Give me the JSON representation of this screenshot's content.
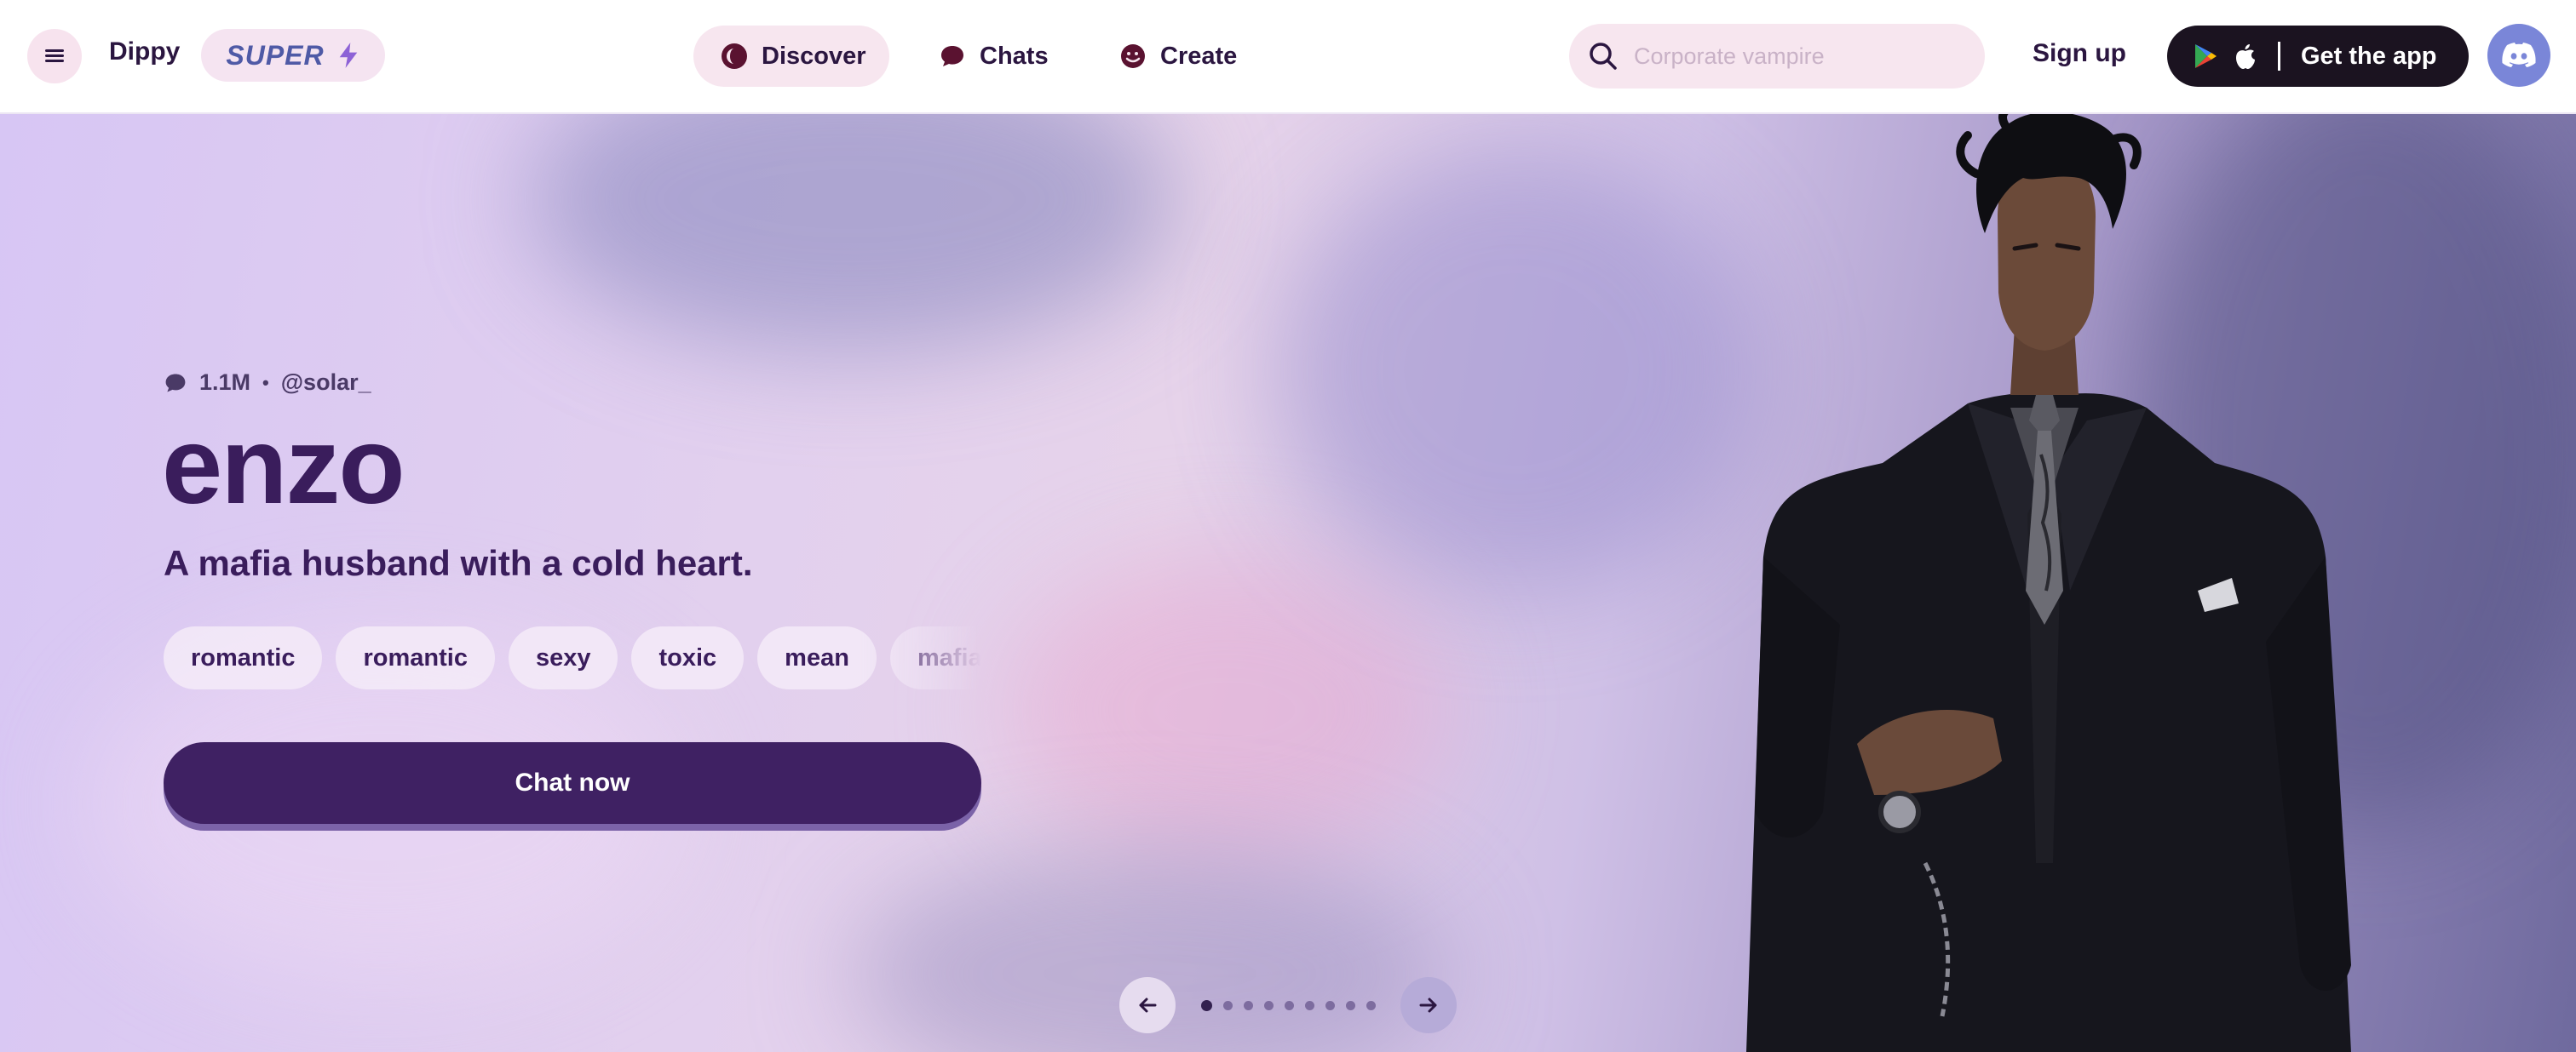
{
  "nav": {
    "brand": "Dippy",
    "super_label": "SUPER",
    "tabs": [
      {
        "label": "Discover",
        "icon": "discover-icon",
        "active": true
      },
      {
        "label": "Chats",
        "icon": "chat-bubble-icon",
        "active": false
      },
      {
        "label": "Create",
        "icon": "create-icon",
        "active": false
      }
    ],
    "search_placeholder": "Corporate vampire",
    "sign_up": "Sign up",
    "get_app": "Get the app"
  },
  "hero": {
    "message_count": "1.1M",
    "separator": "•",
    "creator": "@solar_",
    "name": "enzo",
    "tagline": "A mafia husband with a cold heart.",
    "tags": [
      "romantic",
      "romantic",
      "sexy",
      "toxic",
      "mean",
      "mafia"
    ],
    "cta": "Chat now",
    "pager": {
      "total": 9,
      "current": 1
    }
  },
  "colors": {
    "accent": "#3f2163",
    "pill": "#f7e6ef",
    "dark_button": "#1b1320",
    "discord": "#7a86d8"
  }
}
